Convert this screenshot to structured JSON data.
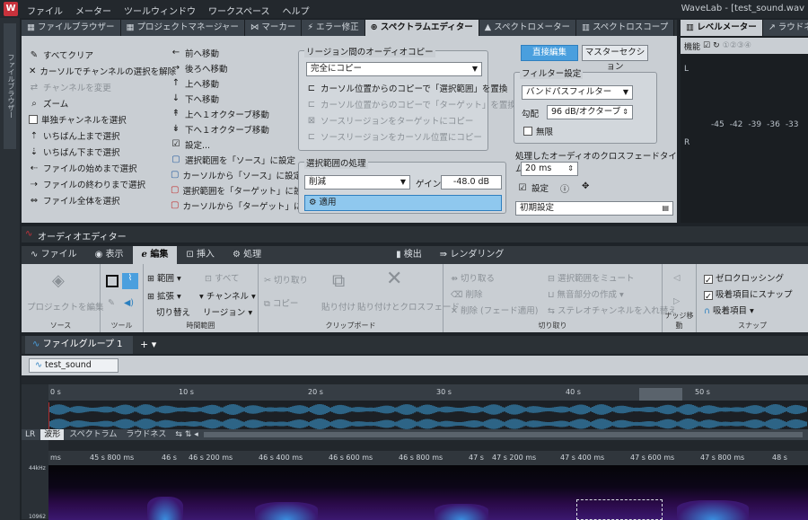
{
  "titlebar": {
    "menu": [
      "ファイル",
      "メーター",
      "ツールウィンドウ",
      "ワークスペース",
      "ヘルプ"
    ],
    "title": "WaveLab - [test_sound.wav"
  },
  "leftstrip": {
    "label": "ファイルブラウザー"
  },
  "toptabs": [
    {
      "label": "ファイルブラウザー",
      "icon": "folder-icon"
    },
    {
      "label": "プロジェクトマネージャー",
      "icon": "grid-icon"
    },
    {
      "label": "マーカー",
      "icon": "marker-icon"
    },
    {
      "label": "エラー修正",
      "icon": "lightning-icon"
    },
    {
      "label": "スペクトラムエディター",
      "icon": "spectrum-icon",
      "active": true
    },
    {
      "label": "スペクトロメーター",
      "icon": "spectrometer-icon"
    },
    {
      "label": "スペクトロスコープ",
      "icon": "chart-icon"
    }
  ],
  "spectrum": {
    "left_commands": [
      {
        "label": "すべてクリア",
        "icon": "brush-icon"
      },
      {
        "label": "カーソルでチャンネルの選択を解除",
        "icon": "x-icon"
      },
      {
        "label": "チャンネルを変更",
        "icon": "swap-icon",
        "disabled": true
      },
      {
        "label": "ズーム",
        "icon": "zoom-icon"
      },
      {
        "label": "単独チャンネルを選択",
        "icon": "checkbox-icon"
      },
      {
        "label": "いちばん上まで選択",
        "icon": "select-top-icon"
      },
      {
        "label": "いちばん下まで選択",
        "icon": "select-bottom-icon"
      },
      {
        "label": "ファイルの始めまで選択",
        "icon": "select-start-icon"
      },
      {
        "label": "ファイルの終わりまで選択",
        "icon": "select-end-icon"
      },
      {
        "label": "ファイル全体を選択",
        "icon": "select-all-icon"
      }
    ],
    "mid_commands": [
      {
        "label": "前へ移動",
        "icon": "arrow-left-icon"
      },
      {
        "label": "後ろへ移動",
        "icon": "arrow-right-icon"
      },
      {
        "label": "上へ移動",
        "icon": "arrow-up-icon"
      },
      {
        "label": "下へ移動",
        "icon": "arrow-down-icon"
      },
      {
        "label": "上へ１オクターブ移動",
        "icon": "octave-up-icon"
      },
      {
        "label": "下へ１オクターブ移動",
        "icon": "octave-down-icon"
      },
      {
        "label": "設定...",
        "icon": "settings-check-icon"
      },
      {
        "label": "選択範囲を「ソース」に設定",
        "icon": "source-icon"
      },
      {
        "label": "カーソルから「ソース」に設定",
        "icon": "source-cursor-icon"
      },
      {
        "label": "選択範囲を「ターゲット」に設定",
        "icon": "target-icon"
      },
      {
        "label": "カーソルから「ターゲット」に設定",
        "icon": "target-cursor-icon"
      }
    ],
    "copy_group": {
      "title": "リージョン間のオーディオコピー",
      "select_value": "完全にコピー",
      "options": [
        {
          "label": "カーソル位置からのコピーで「選択範囲」を置換",
          "disabled": false
        },
        {
          "label": "カーソル位置からのコピーで「ターゲット」を置換",
          "disabled": true
        },
        {
          "label": "ソースリージョンをターゲットにコピー",
          "disabled": true
        },
        {
          "label": "ソースリージョンをカーソル位置にコピー",
          "disabled": true
        }
      ]
    },
    "process_group": {
      "title": "選択範囲の処理",
      "select_value": "削減",
      "gain_label": "ゲイン",
      "gain_value": "-48.0 dB",
      "apply_label": "適用"
    },
    "direct_edit": "直接編集",
    "master_section": "マスターセクション",
    "filter_group": {
      "title": "フィルター設定",
      "select_value": "バンドパスフィルター",
      "slope_label": "勾配",
      "slope_value": "96 dB/オクターブ",
      "infinite_label": "無限"
    },
    "crossfade_label": "処理したオーディオのクロスフェードタイム",
    "crossfade_value": "20 ms",
    "preset_label": "設定",
    "preset_value": "初期設定"
  },
  "meter": {
    "tabs": [
      "レベルメーター",
      "ラウドネスメ"
    ],
    "func_label": "機能",
    "channels": [
      "L",
      "R"
    ],
    "scale": [
      "-45",
      "-42",
      "-39",
      "-36",
      "-33"
    ]
  },
  "audio_editor": {
    "title": "オーディオエディター",
    "tabs": [
      {
        "label": "ファイル",
        "icon": "file-icon"
      },
      {
        "label": "表示",
        "icon": "eye-icon"
      },
      {
        "label": "編集",
        "icon": "edit-icon",
        "active": true
      },
      {
        "label": "挿入",
        "icon": "insert-icon"
      },
      {
        "label": "処理",
        "icon": "process-icon"
      },
      {
        "label": "検出",
        "icon": "detect-icon"
      },
      {
        "label": "レンダリング",
        "icon": "render-icon"
      }
    ],
    "ribbon": {
      "source_label": "ソース",
      "edit_project": "プロジェクトを編集",
      "tool_label": "ツール",
      "time_range_label": "時間範囲",
      "range": "範囲",
      "all": "すべて",
      "expand": "拡張",
      "channel": "チャンネル",
      "toggle": "切り替え",
      "region": "リージョン",
      "clipboard_label": "クリップボード",
      "cut": "切り取り",
      "copy": "コピー",
      "paste": "貼り付け",
      "paste_crossfade": "貼り付けとクロスフェード",
      "trim_label": "切り取り",
      "trim": "切り取る",
      "delete": "削除",
      "delete_fade": "削除 (フェード適用)",
      "mute_sel": "選択範囲をミュート",
      "silence": "無音部分の作成",
      "swap_stereo": "ステレオチャンネルを入れ替え",
      "nudge_label": "ナッジ移動",
      "snap_label": "スナップ",
      "zero_crossing": "ゼロクロッシング",
      "snap_to_magnets": "吸着項目にスナップ",
      "magnets": "吸着項目"
    },
    "file_group_tab": "ファイルグループ 1",
    "file_tab": "test_sound",
    "overview_ticks": [
      "0 s",
      "10 s",
      "20 s",
      "30 s",
      "40 s",
      "50 s"
    ],
    "view_tabs": [
      "LR",
      "波形",
      "スペクトラム",
      "ラウドネス"
    ],
    "ruler_ticks": [
      "ms",
      "45 s 800 ms",
      "46 s",
      "46 s 200 ms",
      "46 s 400 ms",
      "46 s 600 ms",
      "46 s 800 ms",
      "47 s",
      "47 s 200 ms",
      "47 s 400 ms",
      "47 s 600 ms",
      "47 s 800 ms",
      "48 s"
    ],
    "freq_labels": [
      "44kHz",
      "10962"
    ]
  }
}
